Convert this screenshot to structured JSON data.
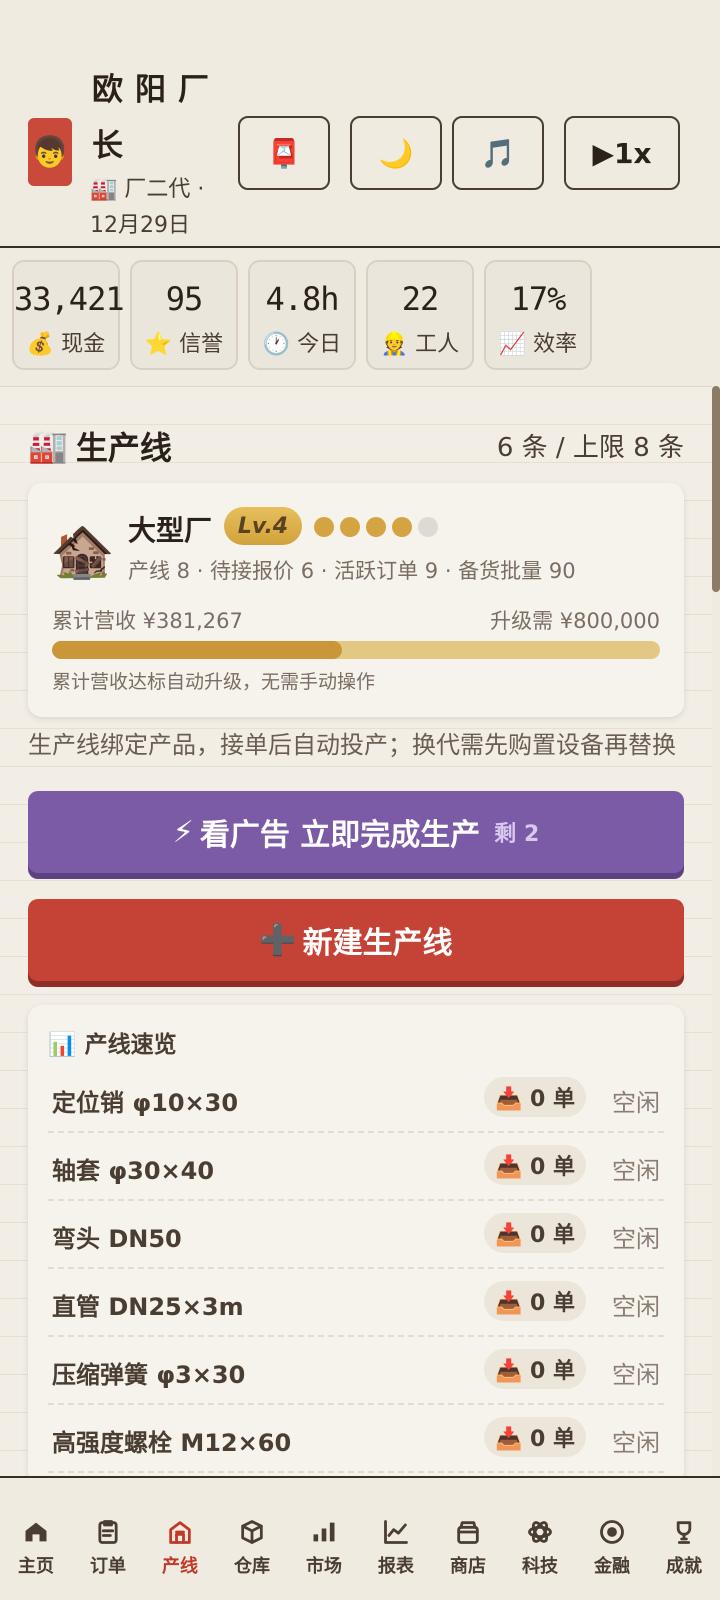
{
  "header": {
    "avatar_emoji": "👦",
    "name": "欧阳厂长",
    "subtitle_icon": "🏭",
    "subtitle": "厂二代 · 12月29日",
    "buttons": [
      {
        "icon": "mailbox-icon",
        "label": "📮"
      },
      {
        "icon": "moon-icon",
        "label": "🌙"
      },
      {
        "icon": "music-icon",
        "label": "🎵"
      },
      {
        "icon": "play-icon",
        "label": "▶1x"
      }
    ]
  },
  "stats": [
    {
      "value": "33,421",
      "label": "💰 现金"
    },
    {
      "value": "95",
      "label": "⭐ 信誉"
    },
    {
      "value": "4.8h",
      "label": "🕐 今日"
    },
    {
      "value": "22",
      "label": "👷 工人"
    },
    {
      "value": "17%",
      "label": "📈 效率"
    }
  ],
  "section": {
    "icon": "🏭",
    "title": "生产线",
    "count": "6 条 / 上限 8 条"
  },
  "factory": {
    "icon": "🏚️",
    "name": "大型厂",
    "level": "Lv.4",
    "stars_filled": 4,
    "stars_total": 5,
    "meta": "产线 8 · 待接报价 6 · 活跃订单 9 · 备货批量 90",
    "revenue": "累计营收 ¥381,267",
    "upgrade": "升级需 ¥800,000",
    "progress": 0.4766,
    "note": "累计营收达标自动升级，无需手动操作"
  },
  "info_line": "生产线绑定产品，接单后自动投产；换代需先购置设备再替换",
  "ad_button": {
    "icon": "⚡",
    "label": "看广告 立即完成生产",
    "remain": "剩 2"
  },
  "new_button": {
    "icon": "➕",
    "label": "新建生产线"
  },
  "overview": {
    "title": "📊 产线速览",
    "rows": [
      {
        "name": "定位销 φ10×30",
        "orders": "📥 0 单",
        "state": "空闲"
      },
      {
        "name": "轴套 φ30×40",
        "orders": "📥 0 单",
        "state": "空闲"
      },
      {
        "name": "弯头 DN50",
        "orders": "📥 0 单",
        "state": "空闲"
      },
      {
        "name": "直管 DN25×3m",
        "orders": "📥 0 单",
        "state": "空闲"
      },
      {
        "name": "压缩弹簧 φ3×30",
        "orders": "📥 0 单",
        "state": "空闲"
      },
      {
        "name": "高强度螺栓 M12×60",
        "orders": "📥 0 单",
        "state": "空闲"
      }
    ]
  },
  "nav": {
    "active": "产线",
    "active_color": "#c0392b",
    "items": [
      {
        "label": "主页",
        "icon": "home-icon"
      },
      {
        "label": "订单",
        "icon": "clipboard-icon"
      },
      {
        "label": "产线",
        "icon": "factory-icon"
      },
      {
        "label": "仓库",
        "icon": "box-icon"
      },
      {
        "label": "市场",
        "icon": "bar-chart-icon"
      },
      {
        "label": "报表",
        "icon": "line-chart-icon"
      },
      {
        "label": "商店",
        "icon": "shop-icon"
      },
      {
        "label": "科技",
        "icon": "atom-icon"
      },
      {
        "label": "金融",
        "icon": "coin-icon"
      },
      {
        "label": "成就",
        "icon": "trophy-icon"
      }
    ]
  }
}
